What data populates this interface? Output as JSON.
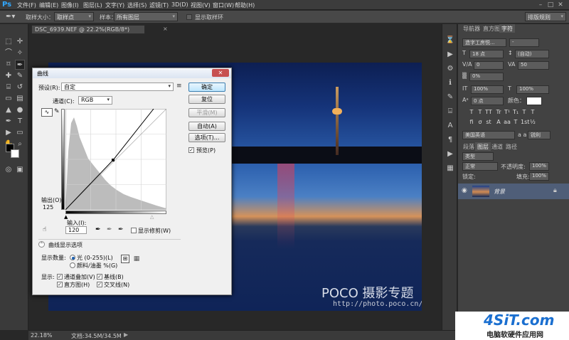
{
  "app": {
    "logo": "Ps"
  },
  "menu": [
    "文件(F)",
    "编辑(E)",
    "图像(I)",
    "图层(L)",
    "文字(Y)",
    "选择(S)",
    "滤镜(T)",
    "3D(D)",
    "视图(V)",
    "窗口(W)",
    "帮助(H)"
  ],
  "window_buttons": [
    "–",
    "□",
    "✕"
  ],
  "options": {
    "sample_size_label": "取样大小：",
    "sample_size_value": "取样点",
    "sample_label": "样本：",
    "sample_value": "所有图层",
    "show_ring_label": "显示取样环",
    "workspace": "排版规则"
  },
  "document": {
    "tab": "DSC_6939.NEF @ 22.2%(RGB/8*)",
    "close": "×",
    "zoom": "22.18%",
    "doc_info": "文档:34.5M/34.5M"
  },
  "watermark": {
    "brand": "POCO 摄影专题",
    "url": "http://photo.poco.cn/"
  },
  "panels": {
    "tabs_top": [
      "导航器",
      "直方图",
      "字符"
    ],
    "font_family": "造字工房悦...",
    "font_style": "-",
    "font_size": "18 点",
    "leading": "(自动)",
    "kerning": "0",
    "tracking": "50",
    "scale_percent": "0%",
    "vscale": "100%",
    "hscale": "100%",
    "baseline": "0 点",
    "color_label": "颜色：",
    "type_buttons": [
      "T",
      "T",
      "TT",
      "Tr",
      "T¹",
      "T₁",
      "T",
      "T"
    ],
    "type_buttons2": [
      "fi",
      "σ",
      "st",
      "A",
      "aa",
      "T",
      "1st",
      "½"
    ],
    "language": "美国英语",
    "aa_label": "a a",
    "aa_value": "锐利",
    "tabs_layers": [
      "段落",
      "图层",
      "通道",
      "路径"
    ],
    "filter_label": "类型",
    "blend_mode": "正常",
    "opacity_label": "不透明度:",
    "opacity_value": "100%",
    "lock_label": "锁定:",
    "fill_label": "填充:",
    "fill_value": "100%",
    "layer_name": "背景"
  },
  "curves": {
    "title": "曲线",
    "preset_label": "预设(R):",
    "preset_value": "自定",
    "channel_label": "通道(C):",
    "channel_value": "RGB",
    "output_label": "输出(O):",
    "output_value": "125",
    "input_label": "输入(I):",
    "input_value": "120",
    "show_clipping": "显示修剪(W)",
    "buttons": {
      "ok": "确定",
      "reset": "复位",
      "smooth": "平滑(M)",
      "auto": "自动(A)",
      "options": "选项(T)..."
    },
    "preview": "预览(P)",
    "display_options_title": "曲线显示选项",
    "show_amount_label": "显示数量:",
    "light_option": "光 (0-255)(L)",
    "pigment_option": "颜料/油墨 %(G)",
    "show_label": "显示:",
    "channel_overlays": "通道叠加(V)",
    "baseline": "基线(B)",
    "histogram": "直方图(H)",
    "intersection": "交叉线(N)"
  },
  "site": {
    "name": "4SiT.com",
    "tagline": "电脑软硬件应用网"
  }
}
